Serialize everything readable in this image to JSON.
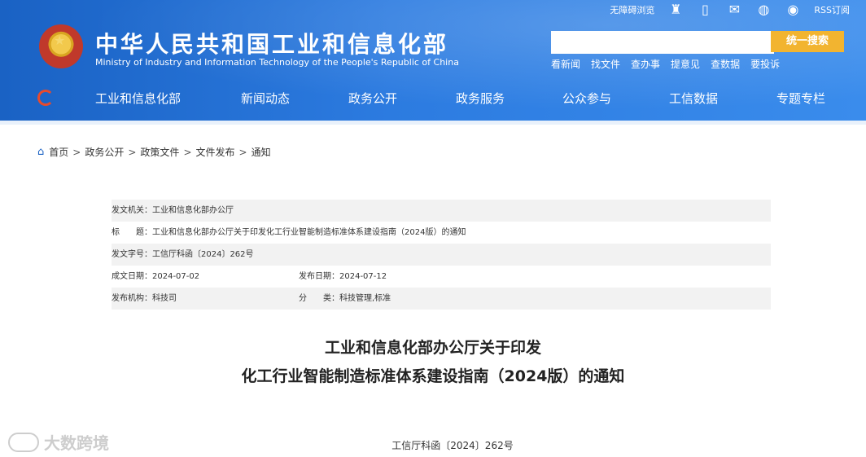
{
  "header": {
    "title": "中华人民共和国工业和信息化部",
    "subtitle": "Ministry of Industry and Information Technology of the People's Republic of China",
    "toplinks": {
      "accessible": "无障碍浏览",
      "rss": "RSS订阅"
    },
    "icons": [
      "figure-icon",
      "mobile-icon",
      "mail-icon",
      "wechat-icon",
      "weibo-icon"
    ],
    "search": {
      "placeholder": "",
      "button": "统一搜索"
    },
    "quicklinks": [
      "看新闻",
      "找文件",
      "查办事",
      "提意见",
      "查数据",
      "要投诉"
    ]
  },
  "nav": [
    "工业和信息化部",
    "新闻动态",
    "政务公开",
    "政务服务",
    "公众参与",
    "工信数据",
    "专题专栏"
  ],
  "breadcrumb": [
    "首页",
    "政务公开",
    "政策文件",
    "文件发布",
    "通知"
  ],
  "meta": {
    "issuer": "发文机关：工业和信息化部办公厅",
    "title": "标　　题：工业和信息化部办公厅关于印发化工行业智能制造标准体系建设指南（2024版）的通知",
    "doc_no": "发文字号：工信厅科函〔2024〕262号",
    "created": "成文日期：2024-07-02",
    "published": "发布日期：2024-07-12",
    "org": "发布机构：科技司",
    "category": "分　　类：科技管理,标准"
  },
  "document": {
    "title_line1": "工业和信息化部办公厅关于印发",
    "title_line2": "化工行业智能制造标准体系建设指南（2024版）的通知",
    "number": "工信厅科函〔2024〕262号"
  },
  "watermark": "大数跨境",
  "colors": {
    "brand_blue": "#1a62c4",
    "search_button": "#f2b430"
  }
}
